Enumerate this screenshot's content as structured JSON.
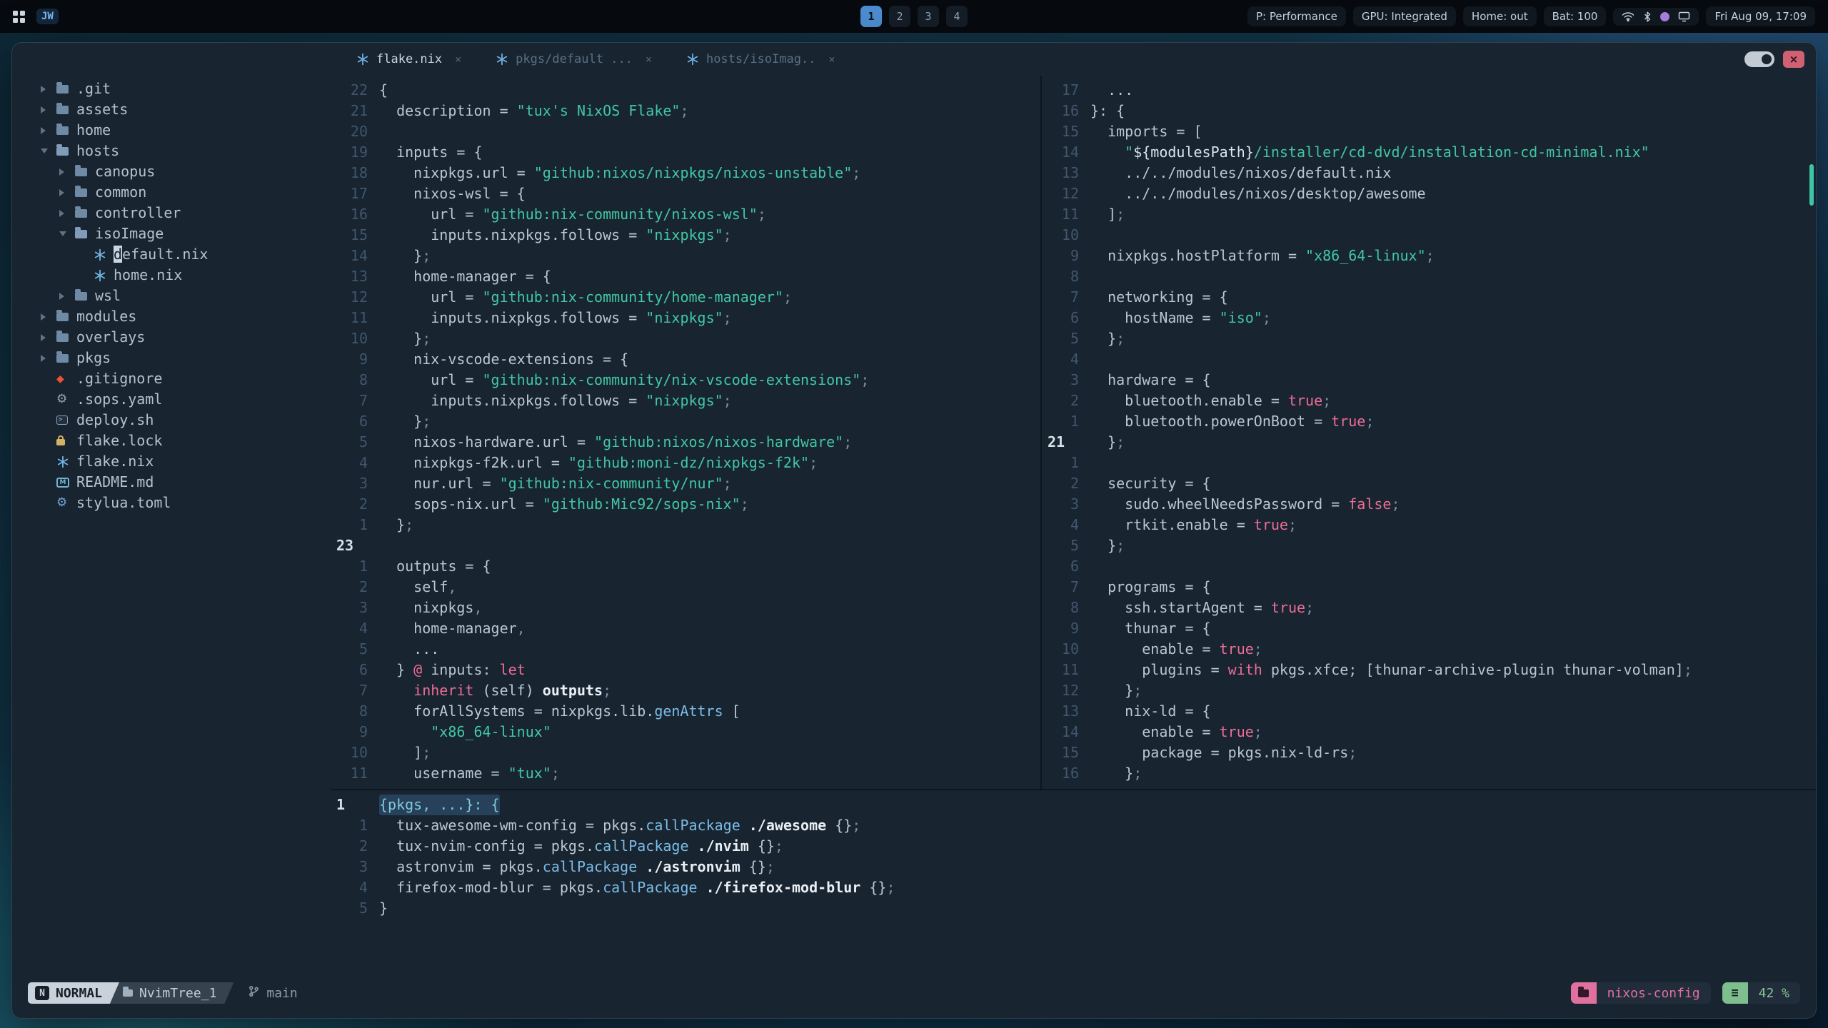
{
  "topbar": {
    "app_badge": "JW",
    "workspaces": [
      "1",
      "2",
      "3",
      "4"
    ],
    "active_workspace": "1",
    "status": [
      "P: Performance",
      "GPU: Integrated",
      "Home: out",
      "Bat: 100"
    ],
    "clock": "Fri Aug 09, 17:09"
  },
  "window": {
    "close_glyph": "×"
  },
  "tabline": {
    "close_glyph": "×",
    "tabs": [
      {
        "icon": "nix",
        "label": "flake.nix",
        "active": true
      },
      {
        "icon": "nix",
        "label": "pkgs/default ...",
        "active": false
      },
      {
        "icon": "nix",
        "label": "hosts/isoImag..",
        "active": false
      }
    ]
  },
  "sidebar": {
    "items": [
      {
        "indent": 0,
        "chevron": "closed",
        "icon": "folder",
        "label": ".git"
      },
      {
        "indent": 0,
        "chevron": "closed",
        "icon": "folder",
        "label": "assets"
      },
      {
        "indent": 0,
        "chevron": "closed",
        "icon": "folder",
        "label": "home"
      },
      {
        "indent": 0,
        "chevron": "open",
        "icon": "folder-open",
        "label": "hosts"
      },
      {
        "indent": 1,
        "chevron": "closed",
        "icon": "folder",
        "label": "canopus"
      },
      {
        "indent": 1,
        "chevron": "closed",
        "icon": "folder",
        "label": "common"
      },
      {
        "indent": 1,
        "chevron": "closed",
        "icon": "folder",
        "label": "controller"
      },
      {
        "indent": 1,
        "chevron": "open",
        "icon": "folder-open",
        "label": "isoImage"
      },
      {
        "indent": 2,
        "icon": "nix",
        "label": "default.nix",
        "cursor": true
      },
      {
        "indent": 2,
        "icon": "nix",
        "label": "home.nix"
      },
      {
        "indent": 1,
        "chevron": "closed",
        "icon": "folder",
        "label": "wsl"
      },
      {
        "indent": 0,
        "chevron": "closed",
        "icon": "folder",
        "label": "modules"
      },
      {
        "indent": 0,
        "chevron": "closed",
        "icon": "folder",
        "label": "overlays"
      },
      {
        "indent": 0,
        "chevron": "closed",
        "icon": "folder",
        "label": "pkgs"
      },
      {
        "indent": 0,
        "icon": "git",
        "label": ".gitignore"
      },
      {
        "indent": 0,
        "icon": "gear",
        "label": ".sops.yaml"
      },
      {
        "indent": 0,
        "icon": "terminal",
        "label": "deploy.sh"
      },
      {
        "indent": 0,
        "icon": "lock",
        "label": "flake.lock"
      },
      {
        "indent": 0,
        "icon": "nix",
        "label": "flake.nix"
      },
      {
        "indent": 0,
        "icon": "markdown",
        "label": "README.md"
      },
      {
        "indent": 0,
        "icon": "gear-blue",
        "label": "stylua.toml"
      }
    ]
  },
  "panes": {
    "left": [
      {
        "n": "22",
        "s": [
          [
            "t",
            "{"
          ]
        ]
      },
      {
        "n": "21",
        "s": [
          [
            "t",
            "  description = "
          ],
          [
            "s",
            "\"tux's NixOS Flake\""
          ],
          [
            "m",
            ";"
          ]
        ]
      },
      {
        "n": "20",
        "s": []
      },
      {
        "n": "19",
        "s": [
          [
            "t",
            "  inputs = {"
          ]
        ]
      },
      {
        "n": "18",
        "s": [
          [
            "t",
            "    nixpkgs.url = "
          ],
          [
            "s",
            "\"github:nixos/nixpkgs/nixos-unstable\""
          ],
          [
            "m",
            ";"
          ]
        ]
      },
      {
        "n": "17",
        "s": [
          [
            "t",
            "    nixos-wsl = {"
          ]
        ]
      },
      {
        "n": "16",
        "s": [
          [
            "t",
            "      url = "
          ],
          [
            "s",
            "\"github:nix-community/nixos-wsl\""
          ],
          [
            "m",
            ";"
          ]
        ]
      },
      {
        "n": "15",
        "s": [
          [
            "t",
            "      inputs.nixpkgs.follows = "
          ],
          [
            "s",
            "\"nixpkgs\""
          ],
          [
            "m",
            ";"
          ]
        ]
      },
      {
        "n": "14",
        "s": [
          [
            "t",
            "    }"
          ],
          [
            "m",
            ";"
          ]
        ]
      },
      {
        "n": "13",
        "s": [
          [
            "t",
            "    home-manager = {"
          ]
        ]
      },
      {
        "n": "12",
        "s": [
          [
            "t",
            "      url = "
          ],
          [
            "s",
            "\"github:nix-community/home-manager\""
          ],
          [
            "m",
            ";"
          ]
        ]
      },
      {
        "n": "11",
        "s": [
          [
            "t",
            "      inputs.nixpkgs.follows = "
          ],
          [
            "s",
            "\"nixpkgs\""
          ],
          [
            "m",
            ";"
          ]
        ]
      },
      {
        "n": "10",
        "s": [
          [
            "t",
            "    }"
          ],
          [
            "m",
            ";"
          ]
        ]
      },
      {
        "n": "9",
        "s": [
          [
            "t",
            "    nix-vscode-extensions = {"
          ]
        ]
      },
      {
        "n": "8",
        "s": [
          [
            "t",
            "      url = "
          ],
          [
            "s",
            "\"github:nix-community/nix-vscode-extensions\""
          ],
          [
            "m",
            ";"
          ]
        ]
      },
      {
        "n": "7",
        "s": [
          [
            "t",
            "      inputs.nixpkgs.follows = "
          ],
          [
            "s",
            "\"nixpkgs\""
          ],
          [
            "m",
            ";"
          ]
        ]
      },
      {
        "n": "6",
        "s": [
          [
            "t",
            "    }"
          ],
          [
            "m",
            ";"
          ]
        ]
      },
      {
        "n": "5",
        "s": [
          [
            "t",
            "    nixos-hardware.url = "
          ],
          [
            "s",
            "\"github:nixos/nixos-hardware\""
          ],
          [
            "m",
            ";"
          ]
        ]
      },
      {
        "n": "4",
        "s": [
          [
            "t",
            "    nixpkgs-f2k.url = "
          ],
          [
            "s",
            "\"github:moni-dz/nixpkgs-f2k\""
          ],
          [
            "m",
            ";"
          ]
        ]
      },
      {
        "n": "3",
        "s": [
          [
            "t",
            "    nur.url = "
          ],
          [
            "s",
            "\"github:nix-community/nur\""
          ],
          [
            "m",
            ";"
          ]
        ]
      },
      {
        "n": "2",
        "s": [
          [
            "t",
            "    sops-nix.url = "
          ],
          [
            "s",
            "\"github:Mic92/sops-nix\""
          ],
          [
            "m",
            ";"
          ]
        ]
      },
      {
        "n": "1",
        "s": [
          [
            "t",
            "  }"
          ],
          [
            "m",
            ";"
          ]
        ]
      },
      {
        "n": "23",
        "c": true,
        "s": []
      },
      {
        "n": "1",
        "s": [
          [
            "t",
            "  outputs = {"
          ]
        ]
      },
      {
        "n": "2",
        "s": [
          [
            "t",
            "    self"
          ],
          [
            "m",
            ","
          ]
        ]
      },
      {
        "n": "3",
        "s": [
          [
            "t",
            "    nixpkgs"
          ],
          [
            "m",
            ","
          ]
        ]
      },
      {
        "n": "4",
        "s": [
          [
            "t",
            "    home-manager"
          ],
          [
            "m",
            ","
          ]
        ]
      },
      {
        "n": "5",
        "s": [
          [
            "t",
            "    ..."
          ]
        ]
      },
      {
        "n": "6",
        "s": [
          [
            "t",
            "  } "
          ],
          [
            "k",
            "@"
          ],
          [
            "t",
            " inputs: "
          ],
          [
            "k",
            "let"
          ]
        ]
      },
      {
        "n": "7",
        "s": [
          [
            "t",
            "    "
          ],
          [
            "k",
            "inherit"
          ],
          [
            "t",
            " (self) "
          ],
          [
            "b",
            "outputs"
          ],
          [
            "m",
            ";"
          ]
        ]
      },
      {
        "n": "8",
        "s": [
          [
            "t",
            "    forAllSystems = nixpkgs.lib."
          ],
          [
            "f",
            "genAttrs"
          ],
          [
            "t",
            " ["
          ]
        ]
      },
      {
        "n": "9",
        "s": [
          [
            "t",
            "      "
          ],
          [
            "s",
            "\"x86_64-linux\""
          ]
        ]
      },
      {
        "n": "10",
        "s": [
          [
            "t",
            "    ]"
          ],
          [
            "m",
            ";"
          ]
        ]
      },
      {
        "n": "11",
        "s": [
          [
            "t",
            "    username = "
          ],
          [
            "s",
            "\"tux\""
          ],
          [
            "m",
            ";"
          ]
        ]
      }
    ],
    "right": [
      {
        "n": "17",
        "s": [
          [
            "t",
            "  ..."
          ]
        ]
      },
      {
        "n": "16",
        "s": [
          [
            "t",
            "}: {"
          ]
        ]
      },
      {
        "n": "15",
        "s": [
          [
            "t",
            "  imports = ["
          ]
        ]
      },
      {
        "n": "14",
        "s": [
          [
            "t",
            "    "
          ],
          [
            "s",
            "\""
          ],
          [
            "e",
            "${modulesPath}"
          ],
          [
            "s",
            "/installer/cd-dvd/installation-cd-minimal.nix\""
          ]
        ]
      },
      {
        "n": "13",
        "s": [
          [
            "t",
            "    ../../modules/nixos/default.nix"
          ]
        ]
      },
      {
        "n": "12",
        "s": [
          [
            "t",
            "    ../../modules/nixos/desktop/awesome"
          ]
        ]
      },
      {
        "n": "11",
        "s": [
          [
            "t",
            "  ]"
          ],
          [
            "m",
            ";"
          ]
        ]
      },
      {
        "n": "10",
        "s": []
      },
      {
        "n": "9",
        "s": [
          [
            "t",
            "  nixpkgs.hostPlatform = "
          ],
          [
            "s",
            "\"x86_64-linux\""
          ],
          [
            "m",
            ";"
          ]
        ]
      },
      {
        "n": "8",
        "s": []
      },
      {
        "n": "7",
        "s": [
          [
            "t",
            "  networking = {"
          ]
        ]
      },
      {
        "n": "6",
        "s": [
          [
            "t",
            "    hostName = "
          ],
          [
            "s",
            "\"iso\""
          ],
          [
            "m",
            ";"
          ]
        ]
      },
      {
        "n": "5",
        "s": [
          [
            "t",
            "  }"
          ],
          [
            "m",
            ";"
          ]
        ]
      },
      {
        "n": "4",
        "s": []
      },
      {
        "n": "3",
        "s": [
          [
            "t",
            "  hardware = {"
          ]
        ]
      },
      {
        "n": "2",
        "s": [
          [
            "t",
            "    bluetooth.enable = "
          ],
          [
            "k",
            "true"
          ],
          [
            "m",
            ";"
          ]
        ]
      },
      {
        "n": "1",
        "s": [
          [
            "t",
            "    bluetooth.powerOnBoot = "
          ],
          [
            "k",
            "true"
          ],
          [
            "m",
            ";"
          ]
        ]
      },
      {
        "n": "21",
        "c": true,
        "s": [
          [
            "t",
            "  }"
          ],
          [
            "m",
            ";"
          ]
        ]
      },
      {
        "n": "1",
        "s": []
      },
      {
        "n": "2",
        "s": [
          [
            "t",
            "  security = {"
          ]
        ]
      },
      {
        "n": "3",
        "s": [
          [
            "t",
            "    sudo.wheelNeedsPassword = "
          ],
          [
            "k",
            "false"
          ],
          [
            "m",
            ";"
          ]
        ]
      },
      {
        "n": "4",
        "s": [
          [
            "t",
            "    rtkit.enable = "
          ],
          [
            "k",
            "true"
          ],
          [
            "m",
            ";"
          ]
        ]
      },
      {
        "n": "5",
        "s": [
          [
            "t",
            "  }"
          ],
          [
            "m",
            ";"
          ]
        ]
      },
      {
        "n": "6",
        "s": []
      },
      {
        "n": "7",
        "s": [
          [
            "t",
            "  programs = {"
          ]
        ]
      },
      {
        "n": "8",
        "s": [
          [
            "t",
            "    ssh.startAgent = "
          ],
          [
            "k",
            "true"
          ],
          [
            "m",
            ";"
          ]
        ]
      },
      {
        "n": "9",
        "s": [
          [
            "t",
            "    thunar = {"
          ]
        ]
      },
      {
        "n": "10",
        "s": [
          [
            "t",
            "      enable = "
          ],
          [
            "k",
            "true"
          ],
          [
            "m",
            ";"
          ]
        ]
      },
      {
        "n": "11",
        "s": [
          [
            "t",
            "      plugins = "
          ],
          [
            "k",
            "with"
          ],
          [
            "t",
            " pkgs.xfce; [thunar-archive-plugin thunar-volman]"
          ],
          [
            "m",
            ";"
          ]
        ]
      },
      {
        "n": "12",
        "s": [
          [
            "t",
            "    }"
          ],
          [
            "m",
            ";"
          ]
        ]
      },
      {
        "n": "13",
        "s": [
          [
            "t",
            "    nix-ld = {"
          ]
        ]
      },
      {
        "n": "14",
        "s": [
          [
            "t",
            "      enable = "
          ],
          [
            "k",
            "true"
          ],
          [
            "m",
            ";"
          ]
        ]
      },
      {
        "n": "15",
        "s": [
          [
            "t",
            "      package = pkgs.nix-ld-rs"
          ],
          [
            "m",
            ";"
          ]
        ]
      },
      {
        "n": "16",
        "s": [
          [
            "t",
            "    }"
          ],
          [
            "m",
            ";"
          ]
        ]
      }
    ],
    "bottom": [
      {
        "n": "1",
        "c": true,
        "h": true,
        "s": [
          [
            "c",
            "{pkgs, ...}: {"
          ]
        ]
      },
      {
        "n": "1",
        "s": [
          [
            "t",
            "  tux-awesome-wm-config = pkgs."
          ],
          [
            "f",
            "callPackage"
          ],
          [
            "t",
            " "
          ],
          [
            "b",
            "./awesome"
          ],
          [
            "t",
            " {}"
          ],
          [
            "m",
            ";"
          ]
        ]
      },
      {
        "n": "2",
        "s": [
          [
            "t",
            "  tux-nvim-config = pkgs."
          ],
          [
            "f",
            "callPackage"
          ],
          [
            "t",
            " "
          ],
          [
            "b",
            "./nvim"
          ],
          [
            "t",
            " {}"
          ],
          [
            "m",
            ";"
          ]
        ]
      },
      {
        "n": "3",
        "s": [
          [
            "t",
            "  astronvim = pkgs."
          ],
          [
            "f",
            "callPackage"
          ],
          [
            "t",
            " "
          ],
          [
            "b",
            "./astronvim"
          ],
          [
            "t",
            " {}"
          ],
          [
            "m",
            ";"
          ]
        ]
      },
      {
        "n": "4",
        "s": [
          [
            "t",
            "  firefox-mod-blur = pkgs."
          ],
          [
            "f",
            "callPackage"
          ],
          [
            "t",
            " "
          ],
          [
            "b",
            "./firefox-mod-blur"
          ],
          [
            "t",
            " {}"
          ],
          [
            "m",
            ";"
          ]
        ]
      },
      {
        "n": "5",
        "s": [
          [
            "t",
            "}"
          ]
        ]
      }
    ]
  },
  "statusline": {
    "mode_icon": "N",
    "mode": "NORMAL",
    "buffer": "NvimTree_1",
    "branch": "main",
    "project": "nixos-config",
    "lines_icon": "≡",
    "progress": "42 %"
  },
  "colors": {
    "accent_blue": "#4c8ed2",
    "string_teal": "#41c7a5",
    "keyword_pink": "#ec6d96",
    "statusline_pink": "#e0719f",
    "statusline_green": "#7fbe8e",
    "git_orange": "#f05133",
    "nix_blue": "#72b4e6"
  }
}
